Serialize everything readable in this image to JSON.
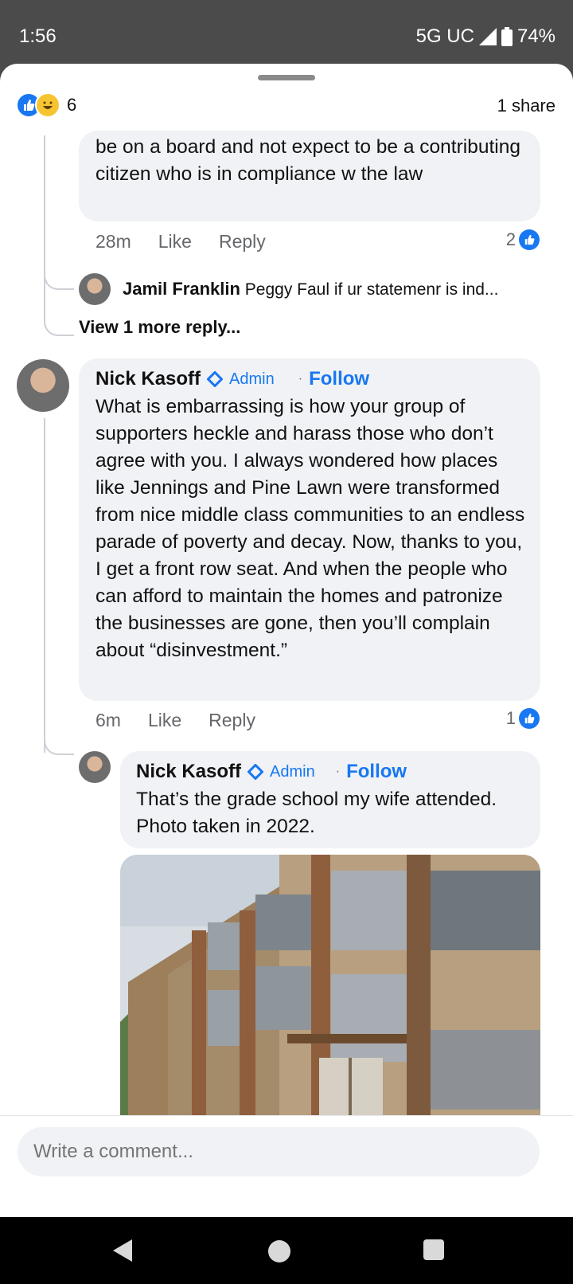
{
  "status": {
    "time": "1:56",
    "network": "5G UC",
    "battery": "74%"
  },
  "reactions": {
    "count": "6",
    "shares": "1 share"
  },
  "comment1": {
    "text": "be on a board and not expect to be a contributing citizen  who is in compliance w the law",
    "time": "28m",
    "like": "Like",
    "reply": "Reply",
    "likes": "2"
  },
  "reply_preview": {
    "name": "Jamil Franklin",
    "text": "Peggy Faul if ur statemenr is ind..."
  },
  "view_more": "View 1 more reply...",
  "comment2": {
    "name": "Nick Kasoff",
    "badge": "Admin",
    "follow": "Follow",
    "text": "What is embarrassing is how your group of supporters heckle and harass those who don’t agree with you. I always wondered how places like Jennings and Pine Lawn were transformed from nice middle class communities to an endless parade of poverty and decay. Now, thanks to you, I get a front row seat. And when the people who can afford to maintain the homes and patronize the businesses are gone, then you’ll complain about “disinvestment.”",
    "time": "6m",
    "like": "Like",
    "reply": "Reply",
    "likes": "1"
  },
  "comment3": {
    "name": "Nick Kasoff",
    "badge": "Admin",
    "follow": "Follow",
    "text": "That’s the grade school my wife attended. Photo taken in 2022."
  },
  "composer": {
    "placeholder": "Write a comment..."
  },
  "colors": {
    "accent": "#1877f2",
    "bubble": "#f0f2f5"
  }
}
